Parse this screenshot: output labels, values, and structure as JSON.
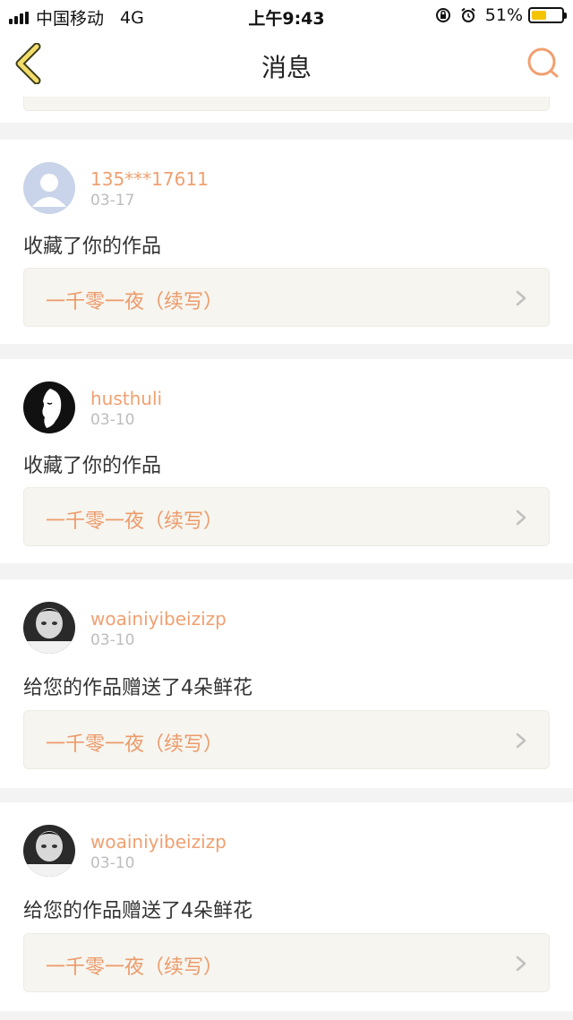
{
  "status_bar": {
    "carrier": "中国移动",
    "network": "4G",
    "time": "上午9:43",
    "battery_percent": "51%",
    "battery_level": 0.51
  },
  "nav": {
    "title": "消息",
    "back_icon": "chevron-left-icon",
    "search_icon": "search-icon"
  },
  "colors": {
    "accent": "#f0a070",
    "card_bg": "#f6f5ef",
    "page_bg": "#f4f3f4"
  },
  "messages": [
    {
      "username": "135***17611",
      "date": "03-17",
      "action": "收藏了你的作品",
      "work_title": "一千零一夜（续写）",
      "avatar": "default-user-avatar"
    },
    {
      "username": "husthuli",
      "date": "03-10",
      "action": "收藏了你的作品",
      "work_title": "一千零一夜（续写）",
      "avatar": "face-silhouette-avatar"
    },
    {
      "username": "woainiyibeizizp",
      "date": "03-10",
      "action": "给您的作品赠送了4朵鲜花",
      "work_title": "一千零一夜（续写）",
      "avatar": "photo-avatar"
    },
    {
      "username": "woainiyibeizizp",
      "date": "03-10",
      "action": "给您的作品赠送了4朵鲜花",
      "work_title": "一千零一夜（续写）",
      "avatar": "photo-avatar"
    }
  ]
}
